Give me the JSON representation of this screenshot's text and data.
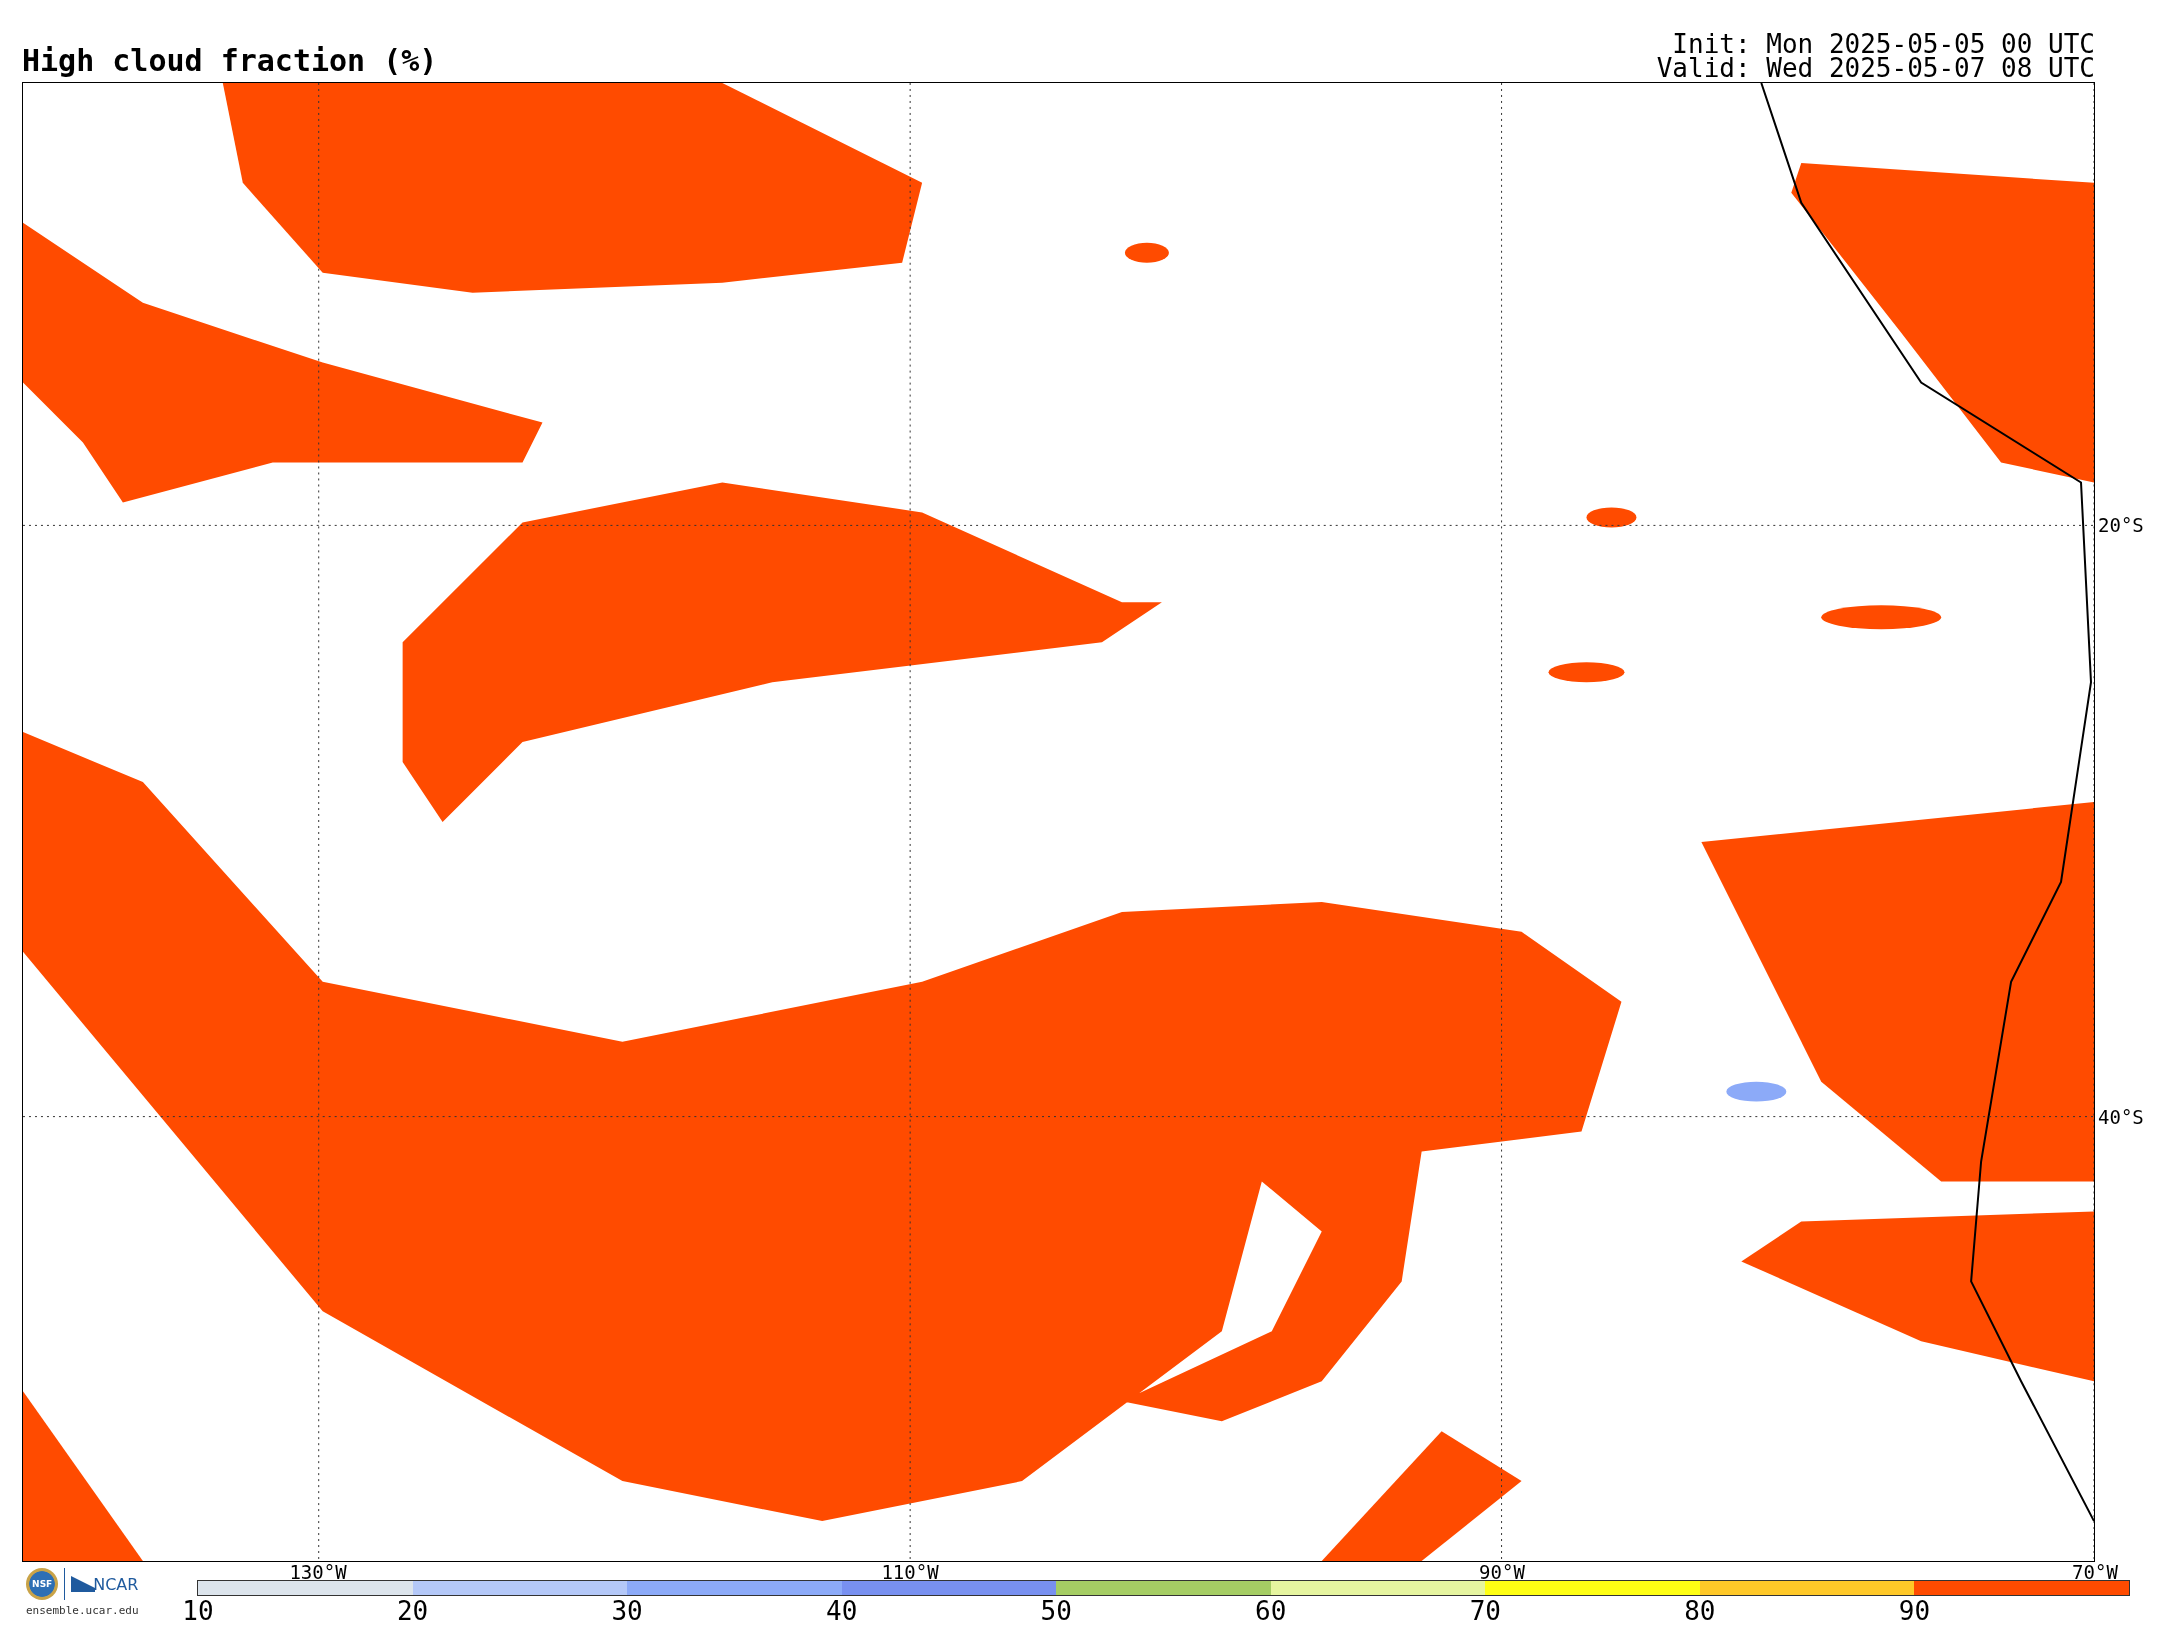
{
  "title": "High cloud fraction (%)",
  "init": "Init: Mon 2025-05-05 00 UTC",
  "valid": "Valid: Wed 2025-05-07 08 UTC",
  "map": {
    "lat_labels": [
      "20°S",
      "40°S"
    ],
    "lon_labels": [
      "130°W",
      "110°W",
      "90°W",
      "70°W"
    ]
  },
  "logos": {
    "nsf": "NSF",
    "ncar": "NCAR",
    "url": "ensemble.ucar.edu"
  },
  "colorbar": [
    {
      "label": "10",
      "color": "#dce4ec"
    },
    {
      "label": "20",
      "color": "#b4c8f8"
    },
    {
      "label": "30",
      "color": "#8caaf8"
    },
    {
      "label": "40",
      "color": "#7890f0"
    },
    {
      "label": "50",
      "color": "#a5cd64"
    },
    {
      "label": "60",
      "color": "#e6f5a0"
    },
    {
      "label": "70",
      "color": "#ffff14"
    },
    {
      "label": "80",
      "color": "#ffc828"
    },
    {
      "label": "90",
      "color": "#ff4b00"
    }
  ]
}
